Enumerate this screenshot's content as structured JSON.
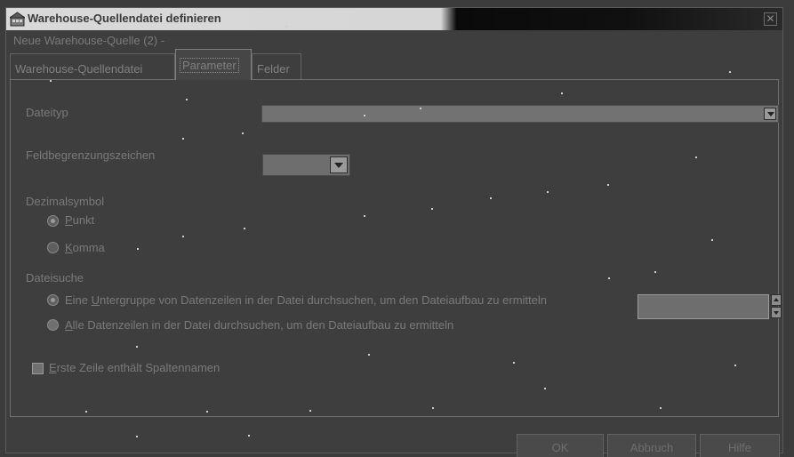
{
  "window": {
    "title": "Warehouse-Quellendatei definieren",
    "close_symbol": "✕",
    "subtitle": "Neue Warehouse-Quelle (2) -"
  },
  "tabs": [
    {
      "label": "Warehouse-Quellendatei"
    },
    {
      "label": "Parameter"
    },
    {
      "label": "Felder"
    }
  ],
  "form": {
    "dateityp_label": "Dateityp",
    "dateityp_value": "",
    "feldbegrenzung_label": "Feldbegrenzungszeichen",
    "feldbegrenzung_value": "",
    "dezimal_group": "Dezimalsymbol",
    "dezimal_options": [
      {
        "pre": "",
        "acc": "P",
        "post": "unkt",
        "checked": true
      },
      {
        "pre": "",
        "acc": "K",
        "post": "omma",
        "checked": false
      }
    ],
    "dateisuche_group": "Dateisuche",
    "dateisuche_options": [
      {
        "pre": "Eine ",
        "acc": "U",
        "post": "ntergruppe von Datenzeilen in der Datei durchsuchen, um den Dateiaufbau zu ermitteln",
        "checked": true
      },
      {
        "pre": "",
        "acc": "A",
        "post": "lle Datenzeilen in der Datei durchsuchen, um den Dateiaufbau zu ermitteln",
        "checked": false
      }
    ],
    "subset_count_value": "",
    "first_row_checkbox": {
      "pre": "",
      "acc": "E",
      "post": "rste Zeile enthält Spaltennamen",
      "checked": false
    }
  },
  "buttons": {
    "ok": "OK",
    "cancel": "Abbruch",
    "help": "Hilfe"
  },
  "icons": {
    "window_icon": "warehouse-icon",
    "dropdown": "chevron-down-icon",
    "spin": "spinner-icon"
  },
  "colors": {
    "background": "#3e3e3e",
    "title_gradient_light": "#d9d9d9",
    "title_gradient_dark": "#0a0a0a",
    "disabled_text": "#7a7a7a"
  }
}
